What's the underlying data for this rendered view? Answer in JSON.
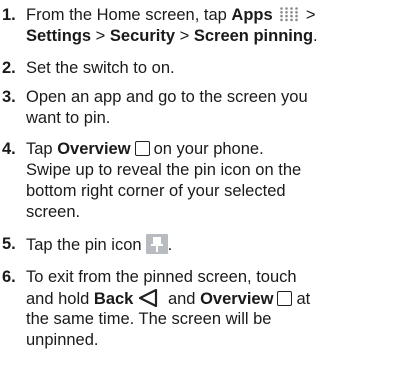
{
  "steps": [
    {
      "number": "1.",
      "line1_pre": "From the Home screen, tap ",
      "line1_apps": "Apps",
      "line1_sep": " > ",
      "line2_settings": "Settings",
      "line2_sep1": " > ",
      "line2_security": "Security",
      "line2_sep2": " > ",
      "line2_pinning": "Screen pinning",
      "line2_end": "."
    },
    {
      "number": "2.",
      "line1": "Set the switch to on."
    },
    {
      "number": "3.",
      "line1": "Open an app and go to the screen you",
      "line2": "want to pin."
    },
    {
      "number": "4.",
      "line1_pre": "Tap ",
      "line1_overview": "Overview",
      "line1_post": "on your phone.",
      "line2": "Swipe up to reveal the pin icon on the",
      "line3": "bottom right corner of your selected",
      "line4": "screen."
    },
    {
      "number": "5.",
      "line1_pre": "Tap the pin icon",
      "line1_post": "."
    },
    {
      "number": "6.",
      "line1": "To exit from the pinned screen, touch",
      "line2_pre": "and hold ",
      "line2_back": "Back",
      "line2_and": " and ",
      "line2_overview": "Overview",
      "line2_post": "at",
      "line3": "the same time. The screen will be",
      "line4": "unpinned."
    }
  ],
  "icons": {
    "apps": "apps-grid-icon",
    "overview": "overview-square-icon",
    "pin": "pin-icon",
    "back": "back-triangle-icon"
  },
  "colors": {
    "text": "#1a1a1a",
    "pin_background": "#b8bcc0",
    "apps_dots": "#8a8a8a"
  }
}
